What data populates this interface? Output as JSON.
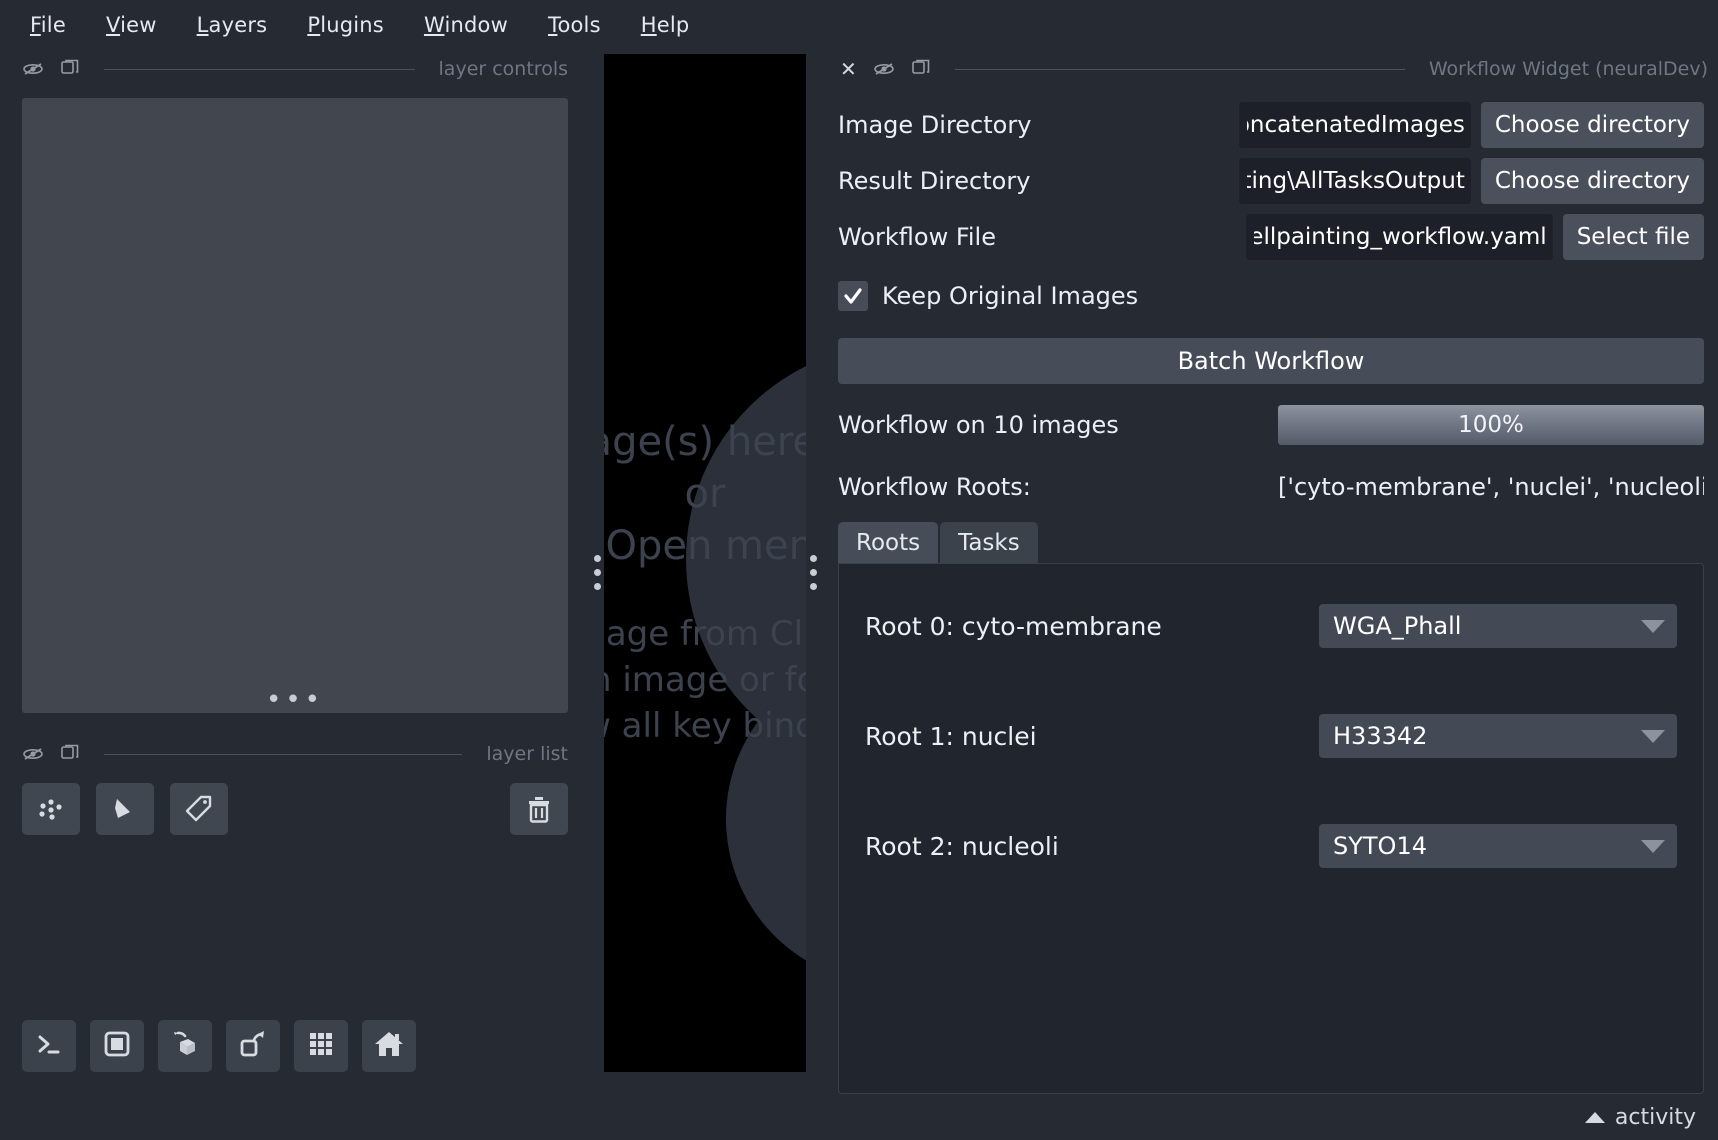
{
  "menubar": {
    "items": [
      {
        "label": "File",
        "accel": "F"
      },
      {
        "label": "View",
        "accel": "V"
      },
      {
        "label": "Layers",
        "accel": "L"
      },
      {
        "label": "Plugins",
        "accel": "P"
      },
      {
        "label": "Window",
        "accel": "W"
      },
      {
        "label": "Tools",
        "accel": "T"
      },
      {
        "label": "Help",
        "accel": "H"
      }
    ]
  },
  "left_dock": {
    "layer_controls_title": "layer controls",
    "layer_list_title": "layer list",
    "layer_buttons": [
      {
        "name": "new-points-layer",
        "icon": "points-icon"
      },
      {
        "name": "new-shapes-layer",
        "icon": "shapes-icon"
      },
      {
        "name": "new-labels-layer",
        "icon": "labels-icon"
      }
    ],
    "delete_button": {
      "name": "delete-layer-button",
      "icon": "trash-icon"
    },
    "bottom_toolbar": [
      {
        "name": "console-button",
        "icon": "console-icon"
      },
      {
        "name": "ndisplay-2d-button",
        "icon": "square-icon"
      },
      {
        "name": "ndisplay-3d-button",
        "icon": "cube-icon"
      },
      {
        "name": "roll-dims-button",
        "icon": "roll-icon"
      },
      {
        "name": "grid-view-button",
        "icon": "grid-icon"
      },
      {
        "name": "home-button",
        "icon": "home-icon"
      }
    ]
  },
  "canvas": {
    "welcome_line1": "Drag image(s) here to open",
    "welcome_line2": "or",
    "welcome_line3": "Use File > Open menu shortcut",
    "hint_line1": "New Image from Clipboard",
    "hint_line2": "open image or folder",
    "hint_line3": "show all key bindings"
  },
  "right_dock": {
    "title": "Workflow Widget (neuralDev)",
    "fields": [
      {
        "label": "Image Directory",
        "value": "ConcatenatedImages",
        "full_value": "ConcatenatedImages",
        "button": "Choose directory"
      },
      {
        "label": "Result Directory",
        "value": "nting\\AllTasksOutput",
        "full_value": "nting\\AllTasksOutput",
        "button": "Choose directory"
      },
      {
        "label": "Workflow File",
        "value": "d_cellpainting_workflow.yaml",
        "full_value": "d_cellpainting_workflow.yaml",
        "button": "Select file"
      }
    ],
    "keep_original": {
      "label": "Keep Original Images",
      "checked": true
    },
    "batch_button": "Batch Workflow",
    "progress": {
      "label": "Workflow on 10 images",
      "percent_text": "100%",
      "percent": 100
    },
    "roots_summary": {
      "label": "Workflow Roots:",
      "value": "['cyto-membrane', 'nuclei', 'nucleoli']"
    },
    "tabs": [
      {
        "label": "Roots",
        "active": true
      },
      {
        "label": "Tasks",
        "active": false
      }
    ],
    "roots": [
      {
        "label": "Root 0: cyto-membrane",
        "channel": "WGA_Phall"
      },
      {
        "label": "Root 1: nuclei",
        "channel": "H33342"
      },
      {
        "label": "Root 2: nucleoli",
        "channel": "SYTO14"
      }
    ]
  },
  "statusbar": {
    "activity_label": "activity"
  },
  "colors": {
    "background": "#262a33",
    "panel": "#21252d",
    "field": "#1d2029",
    "button": "#4b515c",
    "text": "#eceff4",
    "muted": "#6f7684",
    "canvas": "#000000"
  }
}
